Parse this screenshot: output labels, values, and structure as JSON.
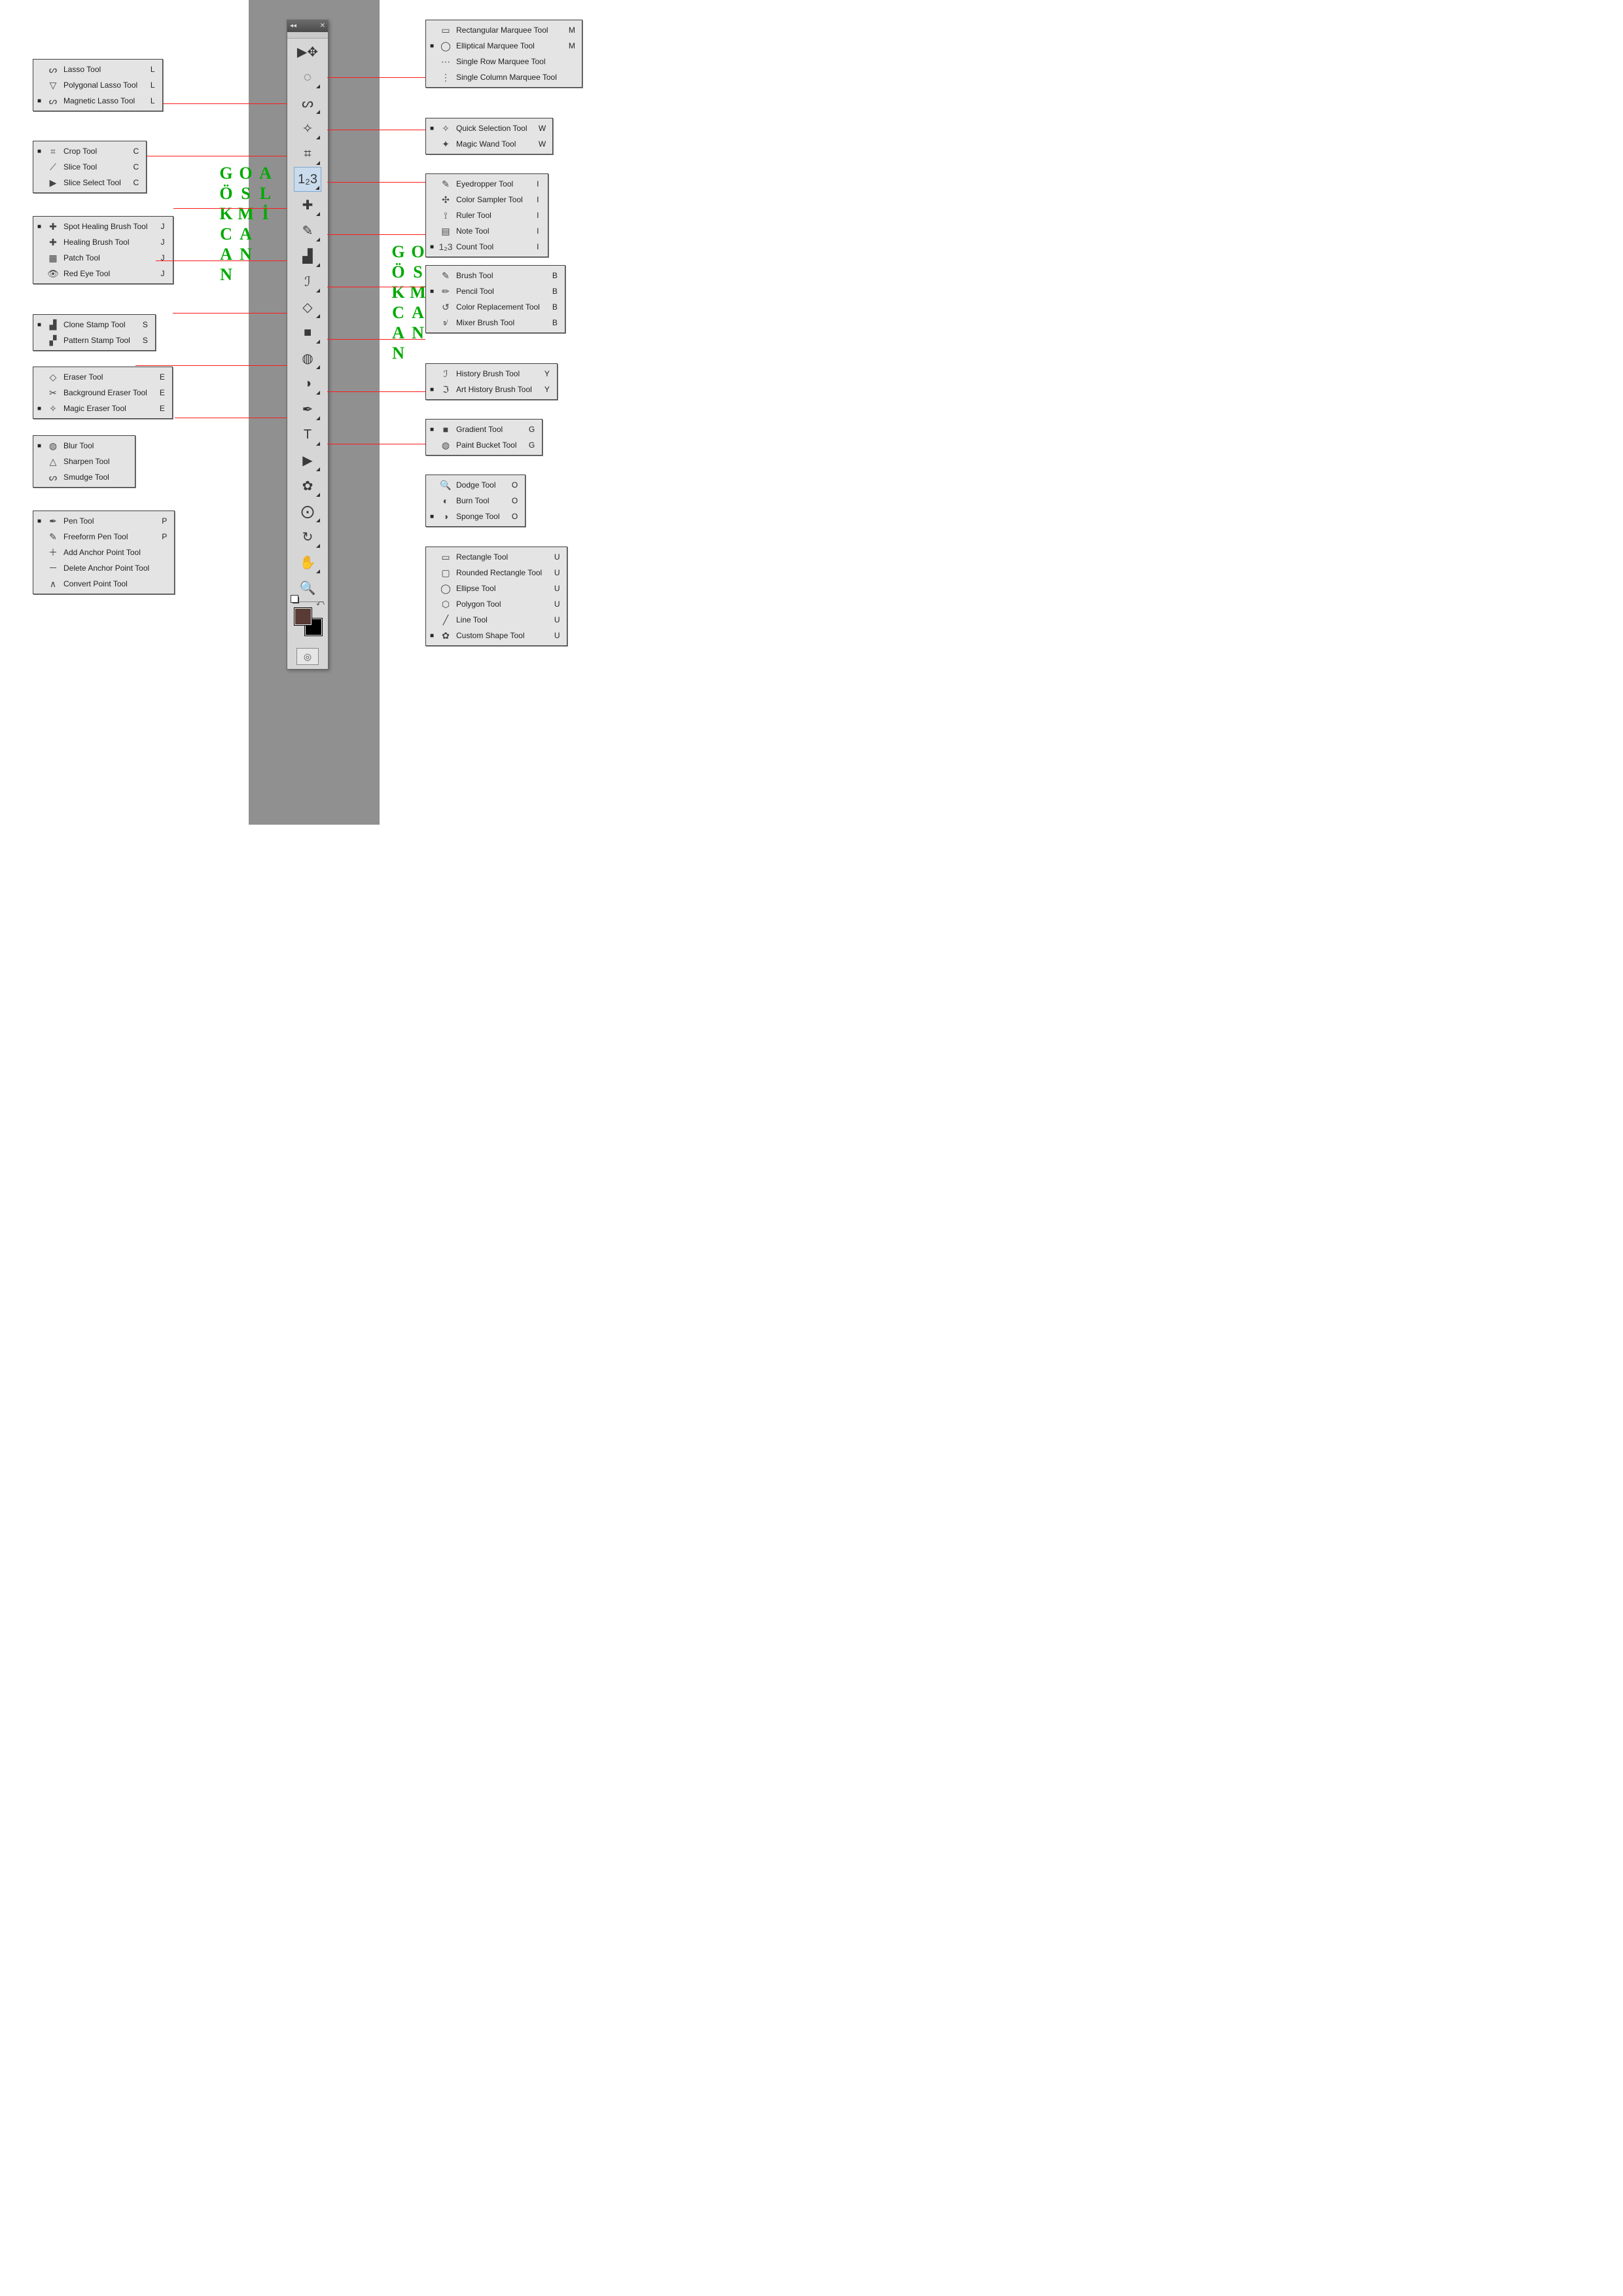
{
  "watermark": "ALİ OSMAN GÖKCAN",
  "toolbar_header": {
    "collapse_glyph": "◂◂",
    "close_glyph": "✕"
  },
  "toolbar_slots": [
    {
      "name": "move-tool",
      "glyph": "▶✥",
      "tri": false
    },
    {
      "name": "marquee-tool",
      "glyph": "◌",
      "tri": true
    },
    {
      "name": "lasso-tool",
      "glyph": "ᔕ",
      "tri": true
    },
    {
      "name": "quick-select-tool",
      "glyph": "✧",
      "tri": true
    },
    {
      "name": "crop-tool",
      "glyph": "⌗",
      "tri": true
    },
    {
      "name": "count-tool",
      "glyph": "1₂3",
      "tri": true,
      "selected": true
    },
    {
      "name": "healing-tool",
      "glyph": "✚",
      "tri": true
    },
    {
      "name": "brush-tool",
      "glyph": "✎",
      "tri": true
    },
    {
      "name": "stamp-tool",
      "glyph": "▟",
      "tri": true
    },
    {
      "name": "history-brush-tool",
      "glyph": "ℐ",
      "tri": true
    },
    {
      "name": "eraser-tool",
      "glyph": "◇",
      "tri": true
    },
    {
      "name": "gradient-tool",
      "glyph": "■",
      "tri": true
    },
    {
      "name": "blur-tool",
      "glyph": "◍",
      "tri": true
    },
    {
      "name": "dodge-tool",
      "glyph": "◑",
      "tri": true
    },
    {
      "name": "pen-tool",
      "glyph": "✒",
      "tri": true
    },
    {
      "name": "type-tool",
      "glyph": "T",
      "tri": true
    },
    {
      "name": "path-select-tool",
      "glyph": "▶",
      "tri": true
    },
    {
      "name": "shape-tool",
      "glyph": "✿",
      "tri": true
    },
    {
      "name": "3d-tool",
      "glyph": "⨀",
      "tri": true
    },
    {
      "name": "3d-camera-tool",
      "glyph": "↻",
      "tri": true
    },
    {
      "name": "hand-tool",
      "glyph": "✋",
      "tri": true
    },
    {
      "name": "zoom-tool",
      "glyph": "🔍",
      "tri": false
    }
  ],
  "flyouts": {
    "marquee": [
      {
        "sel": false,
        "name": "Rectangular Marquee Tool",
        "key": "M"
      },
      {
        "sel": true,
        "name": "Elliptical Marquee Tool",
        "key": "M"
      },
      {
        "sel": false,
        "name": "Single Row Marquee Tool",
        "key": ""
      },
      {
        "sel": false,
        "name": "Single Column Marquee Tool",
        "key": ""
      }
    ],
    "lasso": [
      {
        "sel": false,
        "name": "Lasso Tool",
        "key": "L"
      },
      {
        "sel": false,
        "name": "Polygonal Lasso Tool",
        "key": "L"
      },
      {
        "sel": true,
        "name": "Magnetic Lasso Tool",
        "key": "L"
      }
    ],
    "quicksel": [
      {
        "sel": true,
        "name": "Quick Selection Tool",
        "key": "W"
      },
      {
        "sel": false,
        "name": "Magic Wand Tool",
        "key": "W"
      }
    ],
    "crop": [
      {
        "sel": true,
        "name": "Crop Tool",
        "key": "C"
      },
      {
        "sel": false,
        "name": "Slice Tool",
        "key": "C"
      },
      {
        "sel": false,
        "name": "Slice Select Tool",
        "key": "C"
      }
    ],
    "eyedrop": [
      {
        "sel": false,
        "name": "Eyedropper Tool",
        "key": "I"
      },
      {
        "sel": false,
        "name": "Color Sampler Tool",
        "key": "I"
      },
      {
        "sel": false,
        "name": "Ruler Tool",
        "key": "I"
      },
      {
        "sel": false,
        "name": "Note Tool",
        "key": "I"
      },
      {
        "sel": true,
        "name": "Count Tool",
        "key": "I"
      }
    ],
    "heal": [
      {
        "sel": true,
        "name": "Spot Healing Brush Tool",
        "key": "J"
      },
      {
        "sel": false,
        "name": "Healing Brush Tool",
        "key": "J"
      },
      {
        "sel": false,
        "name": "Patch Tool",
        "key": "J"
      },
      {
        "sel": false,
        "name": "Red Eye Tool",
        "key": "J"
      }
    ],
    "brush": [
      {
        "sel": false,
        "name": "Brush Tool",
        "key": "B"
      },
      {
        "sel": true,
        "name": "Pencil Tool",
        "key": "B"
      },
      {
        "sel": false,
        "name": "Color Replacement Tool",
        "key": "B"
      },
      {
        "sel": false,
        "name": "Mixer Brush Tool",
        "key": "B"
      }
    ],
    "stamp": [
      {
        "sel": true,
        "name": "Clone Stamp Tool",
        "key": "S"
      },
      {
        "sel": false,
        "name": "Pattern Stamp Tool",
        "key": "S"
      }
    ],
    "history": [
      {
        "sel": false,
        "name": "History Brush Tool",
        "key": "Y"
      },
      {
        "sel": true,
        "name": "Art History Brush Tool",
        "key": "Y"
      }
    ],
    "eraser": [
      {
        "sel": false,
        "name": "Eraser Tool",
        "key": "E"
      },
      {
        "sel": false,
        "name": "Background Eraser Tool",
        "key": "E"
      },
      {
        "sel": true,
        "name": "Magic Eraser Tool",
        "key": "E"
      }
    ],
    "gradient": [
      {
        "sel": true,
        "name": "Gradient Tool",
        "key": "G"
      },
      {
        "sel": false,
        "name": "Paint Bucket Tool",
        "key": "G"
      }
    ],
    "blur": [
      {
        "sel": true,
        "name": "Blur Tool",
        "key": ""
      },
      {
        "sel": false,
        "name": "Sharpen Tool",
        "key": ""
      },
      {
        "sel": false,
        "name": "Smudge Tool",
        "key": ""
      }
    ],
    "dodge": [
      {
        "sel": false,
        "name": "Dodge Tool",
        "key": "O"
      },
      {
        "sel": false,
        "name": "Burn Tool",
        "key": "O"
      },
      {
        "sel": true,
        "name": "Sponge Tool",
        "key": "O"
      }
    ],
    "pen": [
      {
        "sel": true,
        "name": "Pen Tool",
        "key": "P"
      },
      {
        "sel": false,
        "name": "Freeform Pen Tool",
        "key": "P"
      },
      {
        "sel": false,
        "name": "Add Anchor Point Tool",
        "key": ""
      },
      {
        "sel": false,
        "name": "Delete Anchor Point Tool",
        "key": ""
      },
      {
        "sel": false,
        "name": "Convert Point Tool",
        "key": ""
      }
    ],
    "shape": [
      {
        "sel": false,
        "name": "Rectangle Tool",
        "key": "U"
      },
      {
        "sel": false,
        "name": "Rounded Rectangle Tool",
        "key": "U"
      },
      {
        "sel": false,
        "name": "Ellipse Tool",
        "key": "U"
      },
      {
        "sel": false,
        "name": "Polygon Tool",
        "key": "U"
      },
      {
        "sel": false,
        "name": "Line Tool",
        "key": "U"
      },
      {
        "sel": true,
        "name": "Custom Shape Tool",
        "key": "U"
      }
    ]
  }
}
